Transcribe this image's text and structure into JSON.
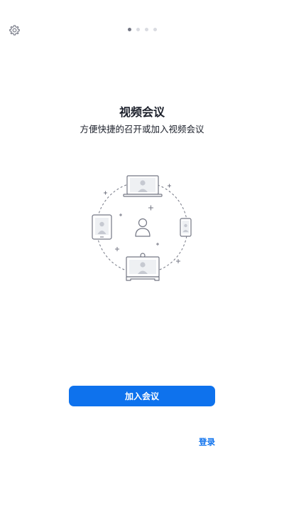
{
  "onboarding": {
    "title": "视频会议",
    "subtitle": "方便快捷的召开或加入视频会议",
    "pager": {
      "total": 4,
      "active": 1
    }
  },
  "actions": {
    "join_label": "加入会议",
    "login_label": "登录"
  },
  "icons": {
    "settings": "gear-icon",
    "illustration": "video-meeting-devices-illustration"
  },
  "colors": {
    "primary": "#0e72ed",
    "text": "#1b1f2a",
    "line": "#747784",
    "dot_inactive": "#d9dbe1"
  }
}
